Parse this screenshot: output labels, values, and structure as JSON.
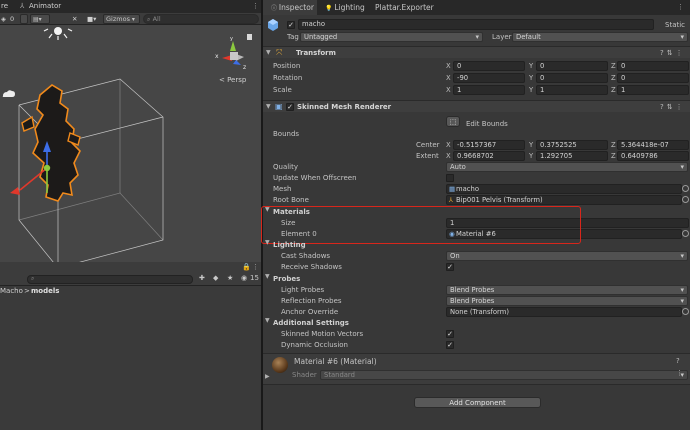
{
  "scene_tabs": {
    "scene_label": "re",
    "animator_label": "Animator"
  },
  "scene_toolbar": {
    "layers_count": "0",
    "gizmos_label": "Gizmos",
    "search_placeholder": "All",
    "persp_label": "< Persp"
  },
  "project": {
    "search_placeholder": "",
    "hidden_count": "15",
    "breadcrumb": [
      "Macho",
      "models"
    ],
    "breadcrumb_sep": ">"
  },
  "inspector_tabs": [
    "Inspector",
    "Lighting",
    "Plattar.Exporter"
  ],
  "object": {
    "name": "macho",
    "static_label": "Static",
    "tag_label": "Tag",
    "tag_value": "Untagged",
    "layer_label": "Layer",
    "layer_value": "Default"
  },
  "transform": {
    "title": "Transform",
    "rows": [
      {
        "label": "Position",
        "x": "0",
        "y": "0",
        "z": "0"
      },
      {
        "label": "Rotation",
        "x": "-90",
        "y": "0",
        "z": "0"
      },
      {
        "label": "Scale",
        "x": "1",
        "y": "1",
        "z": "1"
      }
    ],
    "axes": [
      "X",
      "Y",
      "Z"
    ]
  },
  "smr": {
    "title": "Skinned Mesh Renderer",
    "edit_bounds": "Edit Bounds",
    "bounds_label": "Bounds",
    "center_label": "Center",
    "center": {
      "x": "-0.5157367",
      "y": "0.3752525",
      "z": "5.364418e-07"
    },
    "extent_label": "Extent",
    "extent": {
      "x": "0.9668702",
      "y": "1.292705",
      "z": "0.6409786"
    },
    "quality_label": "Quality",
    "quality_value": "Auto",
    "update_offscreen_label": "Update When Offscreen",
    "mesh_label": "Mesh",
    "mesh_value": "macho",
    "root_bone_label": "Root Bone",
    "root_bone_value": "Bip001 Pelvis (Transform)",
    "materials_label": "Materials",
    "size_label": "Size",
    "size_value": "1",
    "element0_label": "Element 0",
    "element0_value": "Material #6",
    "lighting_label": "Lighting",
    "cast_shadows_label": "Cast Shadows",
    "cast_shadows_value": "On",
    "receive_shadows_label": "Receive Shadows",
    "probes_label": "Probes",
    "light_probes_label": "Light Probes",
    "light_probes_value": "Blend Probes",
    "reflection_probes_label": "Reflection Probes",
    "reflection_probes_value": "Blend Probes",
    "anchor_override_label": "Anchor Override",
    "anchor_override_value": "None (Transform)",
    "additional_label": "Additional Settings",
    "skinned_motion_label": "Skinned Motion Vectors",
    "dynamic_occlusion_label": "Dynamic Occlusion"
  },
  "material": {
    "title": "Material #6 (Material)",
    "shader_label": "Shader",
    "shader_value": "Standard"
  },
  "add_component": "Add Component",
  "colors": {
    "highlight": "#d8261b",
    "background": "#383838",
    "selection_orange": "#f08a1c"
  }
}
